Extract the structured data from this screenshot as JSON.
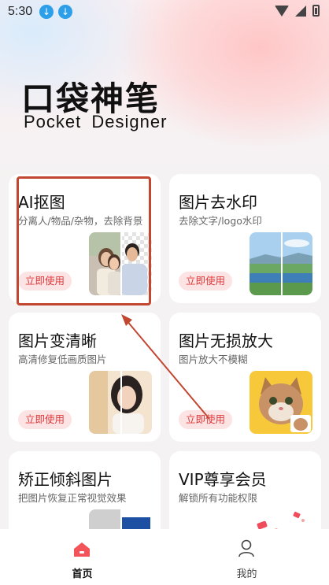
{
  "status_bar": {
    "time": "5:30",
    "icons": [
      "download-icon",
      "download-icon",
      "wifi-icon",
      "signal-icon",
      "battery-icon"
    ]
  },
  "brand": {
    "title": "口袋神笔",
    "subtitle": "Pocket Designer"
  },
  "cards": [
    {
      "title": "AI抠图",
      "desc": "分离人/物品/杂物，去除背景",
      "button": "立即使用",
      "image": "portrait-couple-cutout",
      "highlighted": true
    },
    {
      "title": "图片去水印",
      "desc": "去除文字/logo水印",
      "button": "立即使用",
      "image": "lake-landscape"
    },
    {
      "title": "图片变清晰",
      "desc": "高清修复低画质图片",
      "button": "立即使用",
      "image": "woman-portrait"
    },
    {
      "title": "图片无损放大",
      "desc": "图片放大不模糊",
      "button": "立即使用",
      "image": "cat-photo"
    },
    {
      "title": "矫正倾斜图片",
      "desc": "把图片恢复正常视觉效果",
      "button": "",
      "image": "document-skew"
    },
    {
      "title": "VIP尊享会员",
      "desc": "解锁所有功能权限",
      "button": "",
      "image": "vip-gifts"
    }
  ],
  "bottom_nav": {
    "home_label": "首页",
    "mine_label": "我的"
  },
  "colors": {
    "accent": "#e0383a",
    "button_bg": "#fde4e4",
    "highlight": "#c24730"
  }
}
